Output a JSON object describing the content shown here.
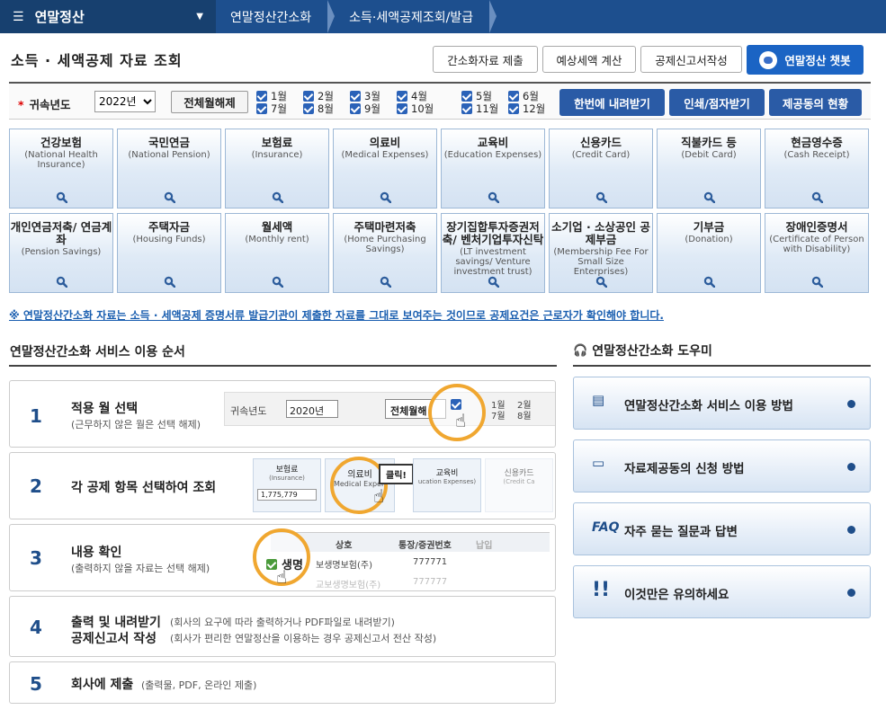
{
  "nav": {
    "home": "연말정산",
    "crumbs": [
      "연말정산간소화",
      "소득·세액공제조회/발급"
    ]
  },
  "page": {
    "title": "소득 · 세액공제 자료 조회"
  },
  "toolbar": {
    "submit": "간소화자료 제출",
    "estimate": "예상세액 계산",
    "report": "공제신고서작성",
    "chatbot": "연말정산 챗봇"
  },
  "filter": {
    "year_label": "귀속년도",
    "year_value": "2022년",
    "clear_label": "전체월해제",
    "months": [
      "1월",
      "2월",
      "3월",
      "4월",
      "5월",
      "6월",
      "7월",
      "8월",
      "9월",
      "10월",
      "11월",
      "12월"
    ],
    "download": "한번에 내려받기",
    "print": "인쇄/점자받기",
    "status": "제공동의 현황"
  },
  "categories": [
    {
      "kr": "건강보험",
      "en": "(National Health Insurance)"
    },
    {
      "kr": "국민연금",
      "en": "(National Pension)"
    },
    {
      "kr": "보험료",
      "en": "(Insurance)"
    },
    {
      "kr": "의료비",
      "en": "(Medical Expenses)"
    },
    {
      "kr": "교육비",
      "en": "(Education Expenses)"
    },
    {
      "kr": "신용카드",
      "en": "(Credit Card)"
    },
    {
      "kr": "직불카드 등",
      "en": "(Debit Card)"
    },
    {
      "kr": "현금영수증",
      "en": "(Cash Receipt)"
    },
    {
      "kr": "개인연금저축/ 연금계좌",
      "en": "(Pension Savings)"
    },
    {
      "kr": "주택자금",
      "en": "(Housing Funds)"
    },
    {
      "kr": "월세액",
      "en": "(Monthly rent)"
    },
    {
      "kr": "주택마련저축",
      "en": "(Home Purchasing Savings)"
    },
    {
      "kr": "장기집합투자증권저축/ 벤처기업투자신탁",
      "en": "(LT investment savings/ Venture investment trust)"
    },
    {
      "kr": "소기업 · 소상공인 공제부금",
      "en": "(Membership Fee For Small Size Enterprises)"
    },
    {
      "kr": "기부금",
      "en": "(Donation)"
    },
    {
      "kr": "장애인증명서",
      "en": "(Certificate of Person with Disability)"
    }
  ],
  "notice": "※ 연말정산간소화 자료는 소득 · 세액공제 증명서류 발급기관이 제출한 자료를 그대로 보여주는 것이므로 공제요건은 근로자가 확인해야 합니다.",
  "guide": {
    "title": "연말정산간소화 서비스 이용 순서",
    "steps": [
      {
        "num": "1",
        "title": "적용 월 선택",
        "sub": "(근무하지 않은 월은 선택 해제)"
      },
      {
        "num": "2",
        "title": "각 공제 항목 선택하여 조회",
        "sub": ""
      },
      {
        "num": "3",
        "title": "내용 확인",
        "sub": "(출력하지 않을 자료는 선택 해제)"
      },
      {
        "num": "4",
        "title": "출력 및 내려받기",
        "sub": "(회사의 요구에 따라 출력하거나 PDF파일로 내려받기)",
        "title2": "공제신고서 작성",
        "sub2": "(회사가 편리한 연말정산을 이용하는 경우 공제신고서 전산 작성)"
      },
      {
        "num": "5",
        "title": "회사에 제출",
        "sub": "(출력물, PDF, 온라인 제출)"
      }
    ],
    "ill1": {
      "label": "귀속년도",
      "year": "2020년",
      "btn": "전체월해",
      "m1": "1월",
      "m2": "2월",
      "m7": "7월",
      "m8": "8월"
    },
    "ill2": {
      "t1": "보험료",
      "e1": "(Insurance)",
      "v1": "1,775,779",
      "t2": "의료비",
      "e2": "Medical Expen",
      "click": "클릭!",
      "t3": "교육비",
      "e3": "ucation Expenses)",
      "t4": "신용카드",
      "e4": "(Credit Ca"
    },
    "ill3": {
      "h1": "상호",
      "h2": "통장/증권번호",
      "h3": "납입",
      "r1": "생명",
      "r1b": "보생명보험(주)",
      "r1c": "777771",
      "r2b": "교보생명보험(주)",
      "r2c": "777777"
    }
  },
  "helper": {
    "title": "연말정산간소화 도우미",
    "items": [
      "연말정산간소화 서비스 이용 방법",
      "자료제공동의 신청 방법",
      "자주 묻는 질문과 답변",
      "이것만은 유의하세요"
    ],
    "faq": "FAQ"
  }
}
